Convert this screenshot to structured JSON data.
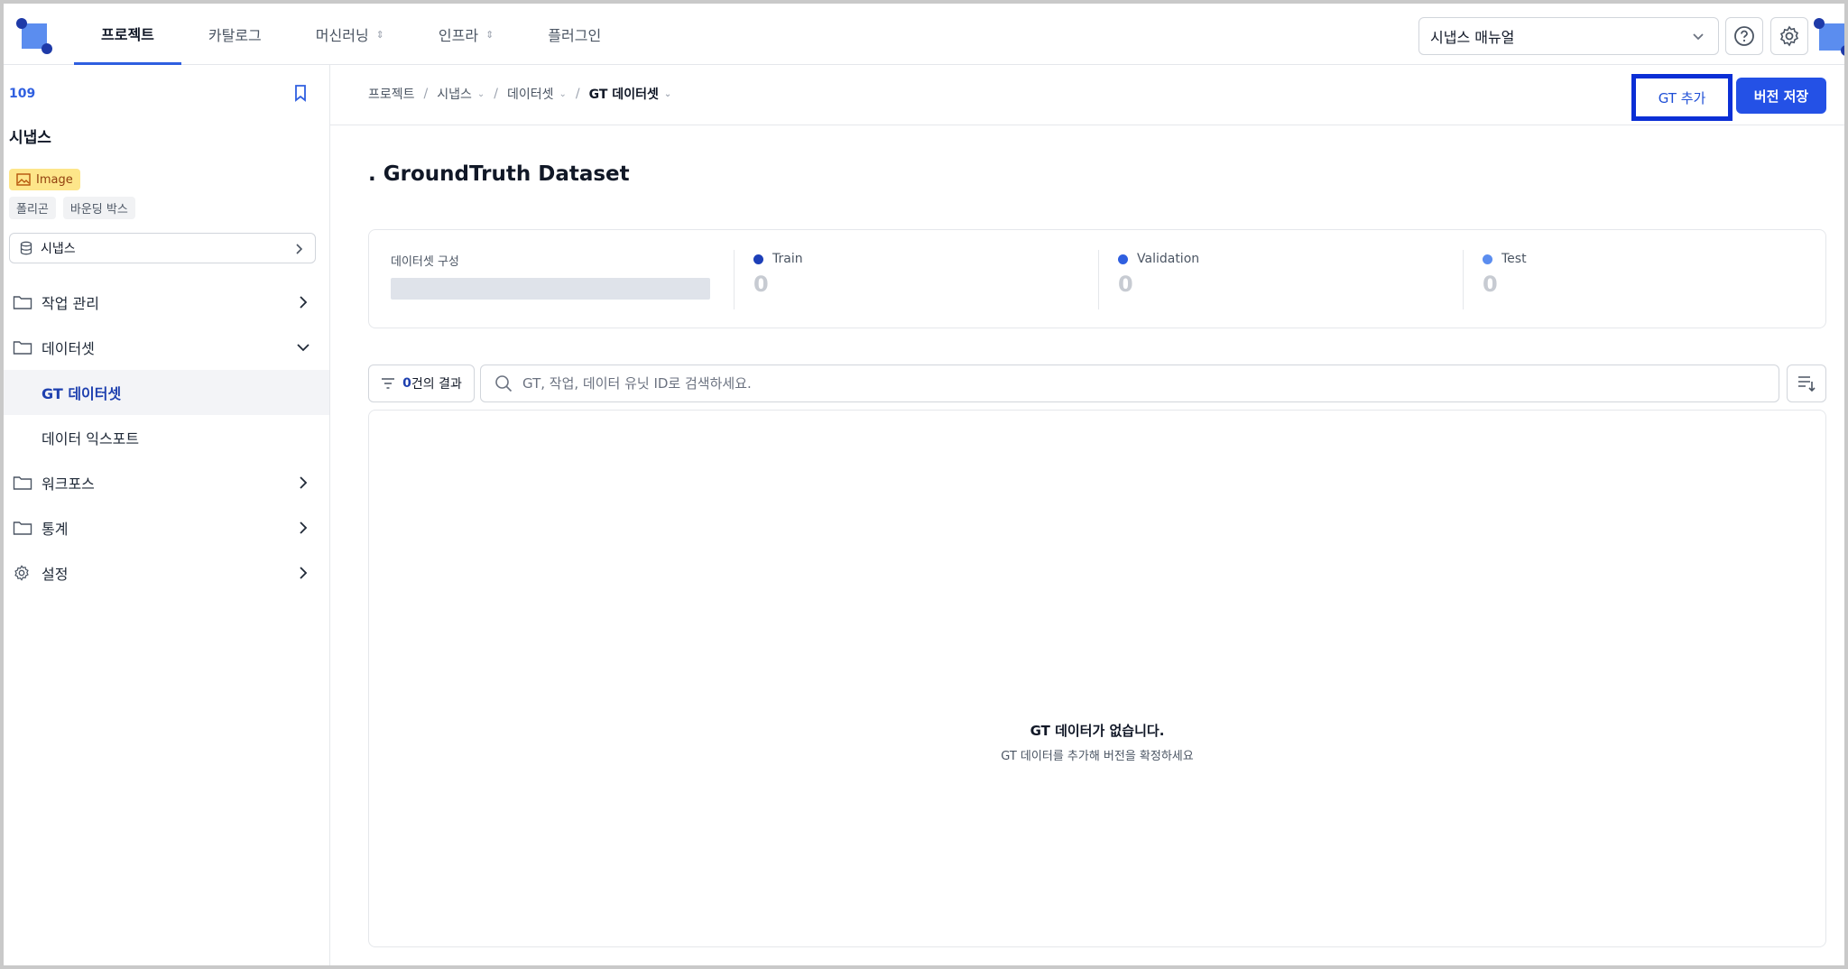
{
  "topnav": {
    "tabs": [
      {
        "label": "프로젝트",
        "active": true
      },
      {
        "label": "카탈로그"
      },
      {
        "label": "머신러닝",
        "caret": "⌃"
      },
      {
        "label": "인프라",
        "caret": "⌃"
      },
      {
        "label": "플러그인"
      }
    ],
    "manual_select": "시냅스 매뉴얼",
    "help_icon": "help-circle-icon",
    "settings_icon": "gear-icon",
    "colors": {
      "accent": "#2451e6",
      "logo": "#5b8def",
      "logo_dot": "#1e3aa8"
    }
  },
  "sidebar": {
    "project_id": "109",
    "project_name": "시냅스",
    "type_badge": "Image",
    "tags": [
      "폴리곤",
      "바운딩 박스"
    ],
    "dataset_select": "시냅스",
    "menu": [
      {
        "label": "작업 관리",
        "icon": "folder-icon",
        "expanded": false
      },
      {
        "label": "데이터셋",
        "icon": "folder-icon",
        "expanded": true
      },
      {
        "label": "GT 데이터셋",
        "sub": true,
        "active": true
      },
      {
        "label": "데이터 익스포트",
        "sub": true
      },
      {
        "label": "워크포스",
        "icon": "folder-icon",
        "expanded": false
      },
      {
        "label": "통계",
        "icon": "folder-icon",
        "expanded": false
      },
      {
        "label": "설정",
        "icon": "gear-icon",
        "expanded": false
      }
    ]
  },
  "main": {
    "breadcrumb": [
      "프로젝트",
      "시냅스",
      "데이터셋",
      "GT 데이터셋"
    ],
    "add_gt_button": "GT 추가",
    "save_version_button": "버전 저장",
    "title": ". GroundTruth Dataset",
    "stats": {
      "compose_label": "데이터셋 구성",
      "items": [
        {
          "label": "Train",
          "value": "0",
          "color": "#1d3fb8"
        },
        {
          "label": "Validation",
          "value": "0",
          "color": "#2f5fe0"
        },
        {
          "label": "Test",
          "value": "0",
          "color": "#5b8def"
        }
      ]
    },
    "filter": {
      "count": "0",
      "suffix": "건의 결과"
    },
    "search_placeholder": "GT, 작업, 데이터 유닛 ID로 검색하세요.",
    "empty_title": "GT 데이터가 없습니다.",
    "empty_subtitle": "GT 데이터를 추가해 버전을 확정하세요"
  }
}
